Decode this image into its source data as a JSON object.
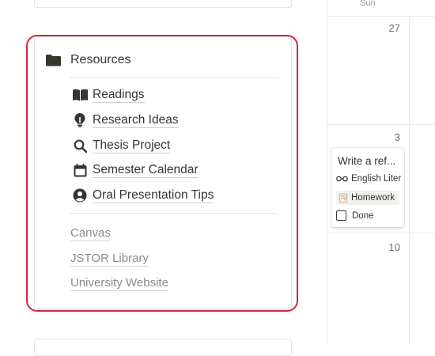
{
  "resources": {
    "title": "Resources",
    "items": [
      {
        "label": "Readings",
        "icon": "book-icon"
      },
      {
        "label": "Research Ideas",
        "icon": "lightbulb-icon"
      },
      {
        "label": "Thesis Project",
        "icon": "search-icon"
      },
      {
        "label": "Semester Calendar",
        "icon": "calendar-icon"
      },
      {
        "label": "Oral Presentation Tips",
        "icon": "user-circle-icon"
      }
    ],
    "links": [
      {
        "label": "Canvas"
      },
      {
        "label": "JSTOR Library"
      },
      {
        "label": "University Website"
      }
    ]
  },
  "calendar": {
    "weekday": "Sun",
    "days": [
      "27",
      "3",
      "10"
    ],
    "event": {
      "title": "Write a ref...",
      "course": "English Liter",
      "tag": "Homework",
      "done_label": "Done",
      "done_checked": false
    }
  },
  "colors": {
    "highlight": "#d0293a",
    "text": "#37352f",
    "muted_link": "#8c8b88"
  }
}
